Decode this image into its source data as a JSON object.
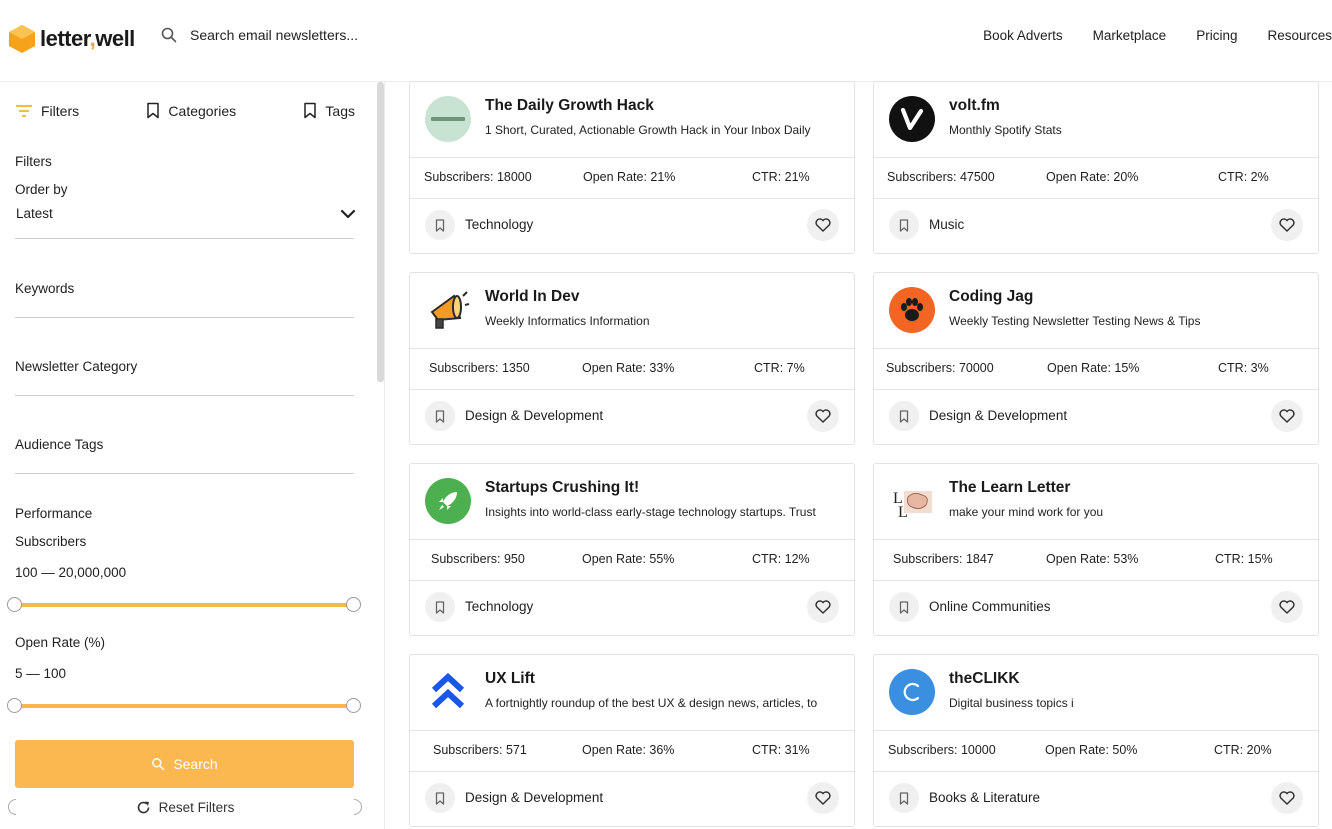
{
  "header": {
    "logo_text_a": "letter",
    "logo_text_comma": ",",
    "logo_text_b": "well",
    "search_placeholder": "Search email newsletters...",
    "nav": [
      "Book Adverts",
      "Marketplace",
      "Pricing",
      "Resources"
    ]
  },
  "sidebar": {
    "tabs": {
      "filters": "Filters",
      "categories": "Categories",
      "tags": "Tags"
    },
    "filters_heading": "Filters",
    "order_by_label": "Order by",
    "order_by_value": "Latest",
    "keywords_label": "Keywords",
    "category_label": "Newsletter Category",
    "audience_label": "Audience Tags",
    "performance_label": "Performance",
    "subscribers_label": "Subscribers",
    "subscribers_range": "100 — 20,000,000",
    "open_rate_label": "Open Rate (%)",
    "open_rate_range": "5 — 100",
    "search_button": "Search",
    "reset_button": "Reset Filters"
  },
  "cards": [
    {
      "title": "The Daily Growth Hack",
      "desc": "1 Short, Curated, Actionable Growth Hack in Your Inbox Daily",
      "subscribers": "Subscribers: 18000",
      "open_rate": "Open Rate: 21%",
      "ctr": "CTR: 21%",
      "category": "Technology",
      "logo_icon": "growth-hack-logo"
    },
    {
      "title": "volt.fm",
      "desc": "Monthly Spotify Stats",
      "subscribers": "Subscribers: 47500",
      "open_rate": "Open Rate: 20%",
      "ctr": "CTR: 2%",
      "category": "Music",
      "logo_icon": "volt-logo"
    },
    {
      "title": "World In Dev",
      "desc": "Weekly Informatics Information",
      "subscribers": "Subscribers: 1350",
      "open_rate": "Open Rate: 33%",
      "ctr": "CTR: 7%",
      "category": "Design & Development",
      "logo_icon": "megaphone-logo"
    },
    {
      "title": "Coding Jag",
      "desc": "Weekly Testing Newsletter Testing News & Tips",
      "subscribers": "Subscribers: 70000",
      "open_rate": "Open Rate: 15%",
      "ctr": "CTR: 3%",
      "category": "Design & Development",
      "logo_icon": "paw-logo"
    },
    {
      "title": "Startups Crushing It!",
      "desc": "Insights into world-class early-stage technology startups. Trust",
      "subscribers": "Subscribers: 950",
      "open_rate": "Open Rate: 55%",
      "ctr": "CTR: 12%",
      "category": "Technology",
      "logo_icon": "rocket-logo"
    },
    {
      "title": "The Learn Letter",
      "desc": "make your mind work for you",
      "subscribers": "Subscribers: 1847",
      "open_rate": "Open Rate: 53%",
      "ctr": "CTR: 15%",
      "category": "Online Communities",
      "logo_icon": "learn-letter-logo"
    },
    {
      "title": "UX Lift",
      "desc": "A fortnightly roundup of the best UX & design news, articles, to",
      "subscribers": "Subscribers: 571",
      "open_rate": "Open Rate: 36%",
      "ctr": "CTR: 31%",
      "category": "Design & Development",
      "logo_icon": "chevrons-up-logo"
    },
    {
      "title": "theCLIKK",
      "desc": "Digital business topics i",
      "subscribers": "Subscribers: 10000",
      "open_rate": "Open Rate: 50%",
      "ctr": "CTR: 20%",
      "category": "Books & Literature",
      "logo_icon": "clikk-logo"
    }
  ],
  "colors": {
    "accent": "#fbb851",
    "range": "#f7b84b"
  }
}
